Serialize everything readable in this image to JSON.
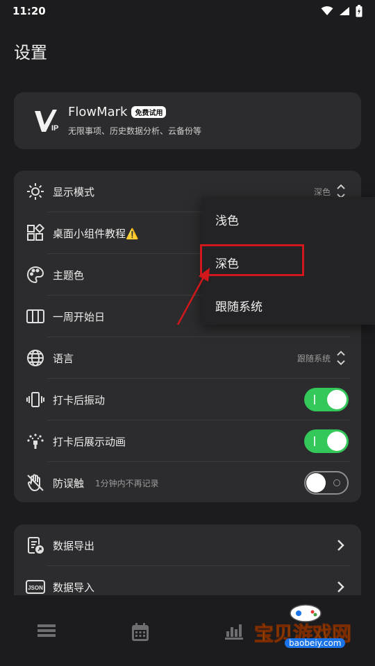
{
  "status_bar": {
    "time": "11:20"
  },
  "page": {
    "title": "设置"
  },
  "vip": {
    "name": "FlowMark",
    "badge": "免费试用",
    "description": "无限事项、历史数据分析、云备份等"
  },
  "settings": {
    "display_mode": {
      "label": "显示模式",
      "value": "深色",
      "icon": "sun-icon"
    },
    "widget_tutorial": {
      "label": "桌面小组件教程⚠️",
      "icon": "widgets-icon"
    },
    "theme_color": {
      "label": "主题色",
      "icon": "palette-icon"
    },
    "week_start": {
      "label": "一周开始日",
      "icon": "columns-icon"
    },
    "language": {
      "label": "语言",
      "value": "跟随系统",
      "icon": "globe-icon"
    },
    "vibrate": {
      "label": "打卡后振动",
      "enabled": true,
      "icon": "vibrate-icon"
    },
    "animation": {
      "label": "打卡后展示动画",
      "enabled": true,
      "icon": "celebration-icon"
    },
    "anti_mistouch": {
      "label": "防误触",
      "sub": "1分钟内不再记录",
      "enabled": false,
      "icon": "hand-off-icon"
    }
  },
  "data_section": {
    "export": {
      "label": "数据导出",
      "icon": "export-icon"
    },
    "import": {
      "label": "数据导入",
      "icon": "json-icon"
    }
  },
  "dropdown": {
    "options": [
      "浅色",
      "深色",
      "跟随系统"
    ],
    "selected": "深色"
  },
  "watermark": {
    "text": "宝贝游戏网",
    "url": "baobeiy.com"
  },
  "colors": {
    "background": "#1c1c1e",
    "card": "#2c2c2e",
    "toggle_on": "#34c759",
    "highlight": "#d0181c"
  }
}
